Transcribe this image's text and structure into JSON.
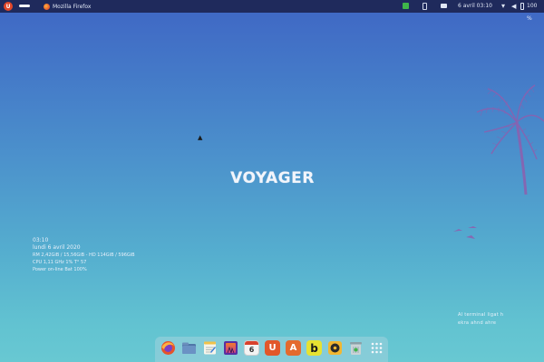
{
  "topbar": {
    "app_menu_letter": "U",
    "window_title": "Mozilla Firefox",
    "clock": "6 avril 03:10",
    "battery": "100 %",
    "colors": {
      "bar": "#1f2a5c",
      "tray_green": "#3fb54a",
      "app_menu": "#e2472a"
    }
  },
  "desktop": {
    "logo": "VOYAGER",
    "conky": {
      "time": "03:10",
      "date": "lundi  6 avril 2020",
      "memory": "RM 2,42GiB / 15,56GiB - HD 114GiB / 596GiB",
      "cpu": "CPU 1,11 GHz 1%  T° 57",
      "power": "Power on-line Bat 100%"
    },
    "quote": {
      "line1": "Al  terminal  ligat  h",
      "line2": "ekra  ahnd  ahre"
    }
  },
  "dock": {
    "items": [
      {
        "name": "firefox",
        "color": "#e5532b"
      },
      {
        "name": "files",
        "color": "#5a7fa6"
      },
      {
        "name": "text-editor",
        "color": "#f0c24b"
      },
      {
        "name": "image-viewer",
        "color": "#7a3fc4"
      },
      {
        "name": "calendar",
        "day": "6",
        "color": "#e8e8e8"
      },
      {
        "name": "ubuntu-software",
        "letter": "U",
        "color": "#e2572a"
      },
      {
        "name": "app-center",
        "letter": "A",
        "color": "#e46a2e"
      },
      {
        "name": "beaker",
        "letter": "b",
        "color": "#e6e232"
      },
      {
        "name": "rhythmbox",
        "color": "#f2b731"
      },
      {
        "name": "trash",
        "color": "#8aa0a8"
      },
      {
        "name": "show-applications",
        "color": "#ffffff"
      }
    ]
  }
}
